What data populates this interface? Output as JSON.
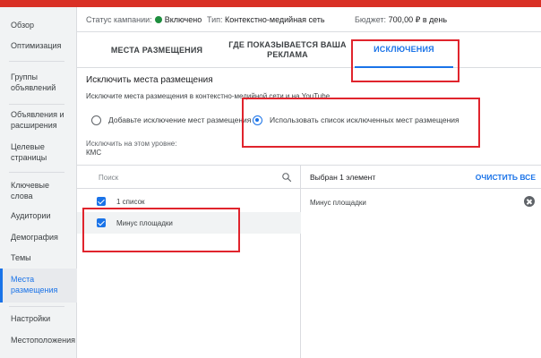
{
  "sidebar": {
    "items": [
      {
        "label": "Обзор"
      },
      {
        "label": "Оптимизация"
      },
      {
        "label": "Группы объявлений"
      },
      {
        "label": "Объявления и расширения"
      },
      {
        "label": "Целевые страницы"
      },
      {
        "label": "Ключевые слова"
      },
      {
        "label": "Аудитории"
      },
      {
        "label": "Демография"
      },
      {
        "label": "Темы"
      },
      {
        "label": "Места размещения"
      },
      {
        "label": "Настройки"
      },
      {
        "label": "Местоположения"
      }
    ]
  },
  "status": {
    "campaign_label": "Статус кампании:",
    "campaign_value": "Включено",
    "type_label": "Тип:",
    "type_value": "Контекстно-медийная сеть",
    "budget_label": "Бюджет:",
    "budget_value": "700,00 ₽ в день"
  },
  "tabs": [
    {
      "label": "МЕСТА РАЗМЕЩЕНИЯ"
    },
    {
      "label": "ГДЕ ПОКАЗЫВАЕТСЯ ВАША РЕКЛАМА"
    },
    {
      "label": "ИСКЛЮЧЕНИЯ"
    }
  ],
  "section_title": "Исключить места размещения",
  "hint": "Исключите места размещения в контекстно-медийной сети и на YouTube.",
  "radio_options": [
    {
      "label": "Добавьте исключение мест размещения"
    },
    {
      "label": "Использовать список исключенных мест размещения"
    }
  ],
  "level": {
    "label": "Исключить на этом уровне:",
    "value": "КМС"
  },
  "search": {
    "placeholder": "Поиск"
  },
  "list_items": [
    {
      "label": "1 список"
    },
    {
      "label": "Минус площадки"
    }
  ],
  "selected_panel": {
    "count": "Выбран 1 элемент",
    "clear_all": "ОЧИСТИТЬ ВСЕ",
    "items": [
      {
        "label": "Минус площадки"
      }
    ]
  },
  "colors": {
    "accent": "#1a73e8",
    "status_green": "#1e8e3e",
    "annotation_red": "#e0242d"
  }
}
